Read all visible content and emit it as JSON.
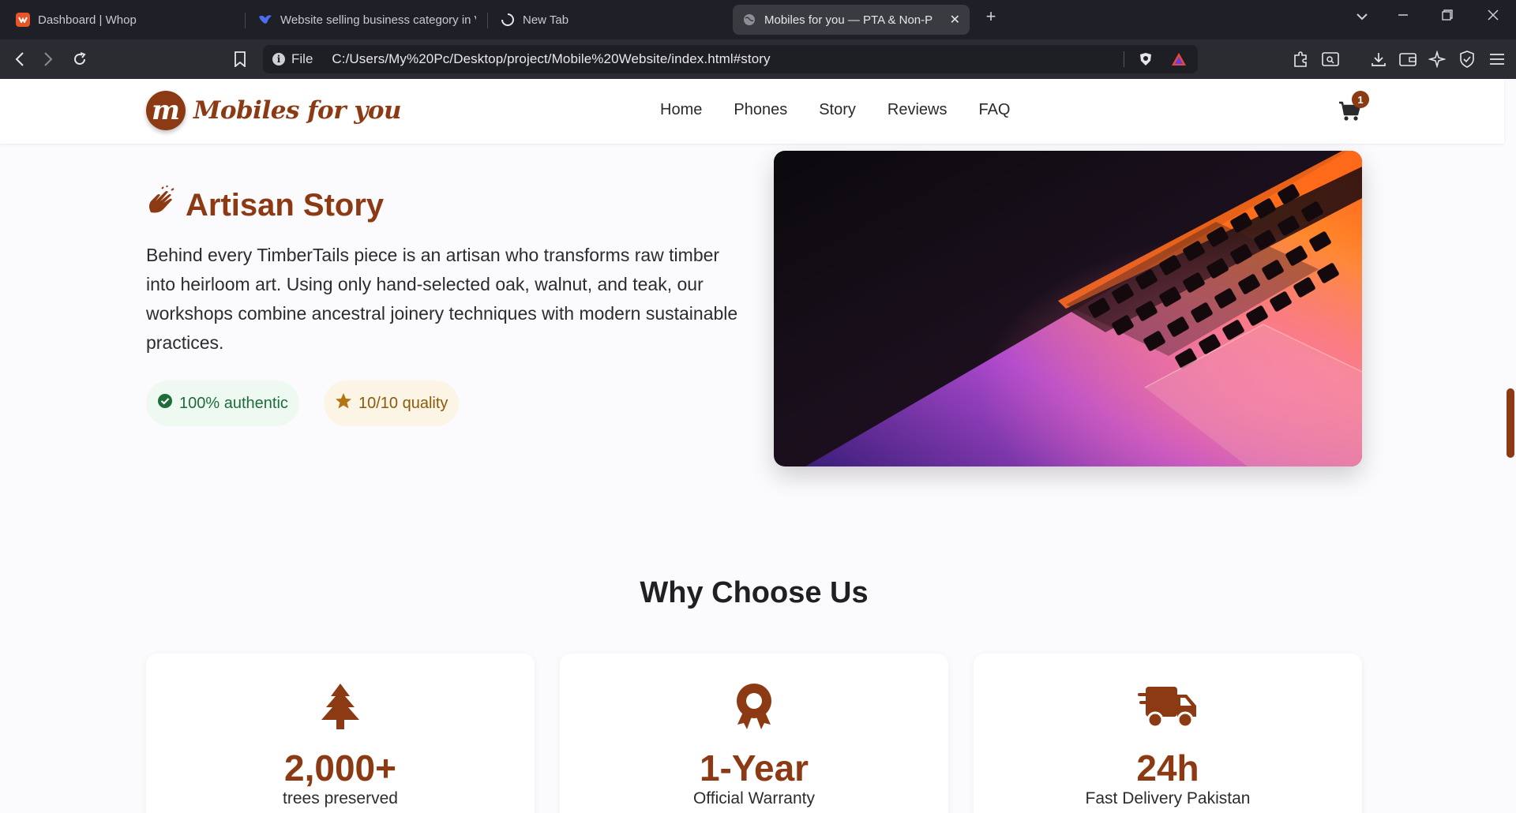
{
  "browser": {
    "tabs": [
      {
        "title": "Dashboard | Whop",
        "icon": "whop-icon"
      },
      {
        "title": "Website selling business category in V",
        "icon": "bird-icon"
      },
      {
        "title": "New Tab",
        "icon": "loading-icon"
      },
      {
        "title": "Mobiles for you — PTA & Non-P",
        "icon": "globe-icon",
        "active": true
      }
    ],
    "url_scheme": "File",
    "url": "C:/Users/My%20Pc/Desktop/project/Mobile%20Website/index.html#story"
  },
  "header": {
    "logo_initial": "m",
    "logo_text": "Mobiles for you",
    "nav": [
      "Home",
      "Phones",
      "Story",
      "Reviews",
      "FAQ"
    ],
    "cart_count": "1"
  },
  "story": {
    "title": "Artisan Story",
    "body": "Behind every TimberTails piece is an artisan who transforms raw timber into heirloom art. Using only hand-selected oak, walnut, and teak, our workshops combine ancestral joinery techniques with modern sustainable practices.",
    "badges": [
      "100% authentic",
      "10/10 quality"
    ]
  },
  "why": {
    "title": "Why Choose Us",
    "cards": [
      {
        "icon": "tree-icon",
        "value": "2,000+",
        "label": "trees preserved"
      },
      {
        "icon": "award-icon",
        "value": "1-Year",
        "label": "Official Warranty"
      },
      {
        "icon": "truck-icon",
        "value": "24h",
        "label": "Fast Delivery Pakistan"
      }
    ]
  },
  "colors": {
    "brand": "#8b3a14",
    "success": "#1f6b3a",
    "star": "#b5740f",
    "browser_bg": "#1f2027"
  }
}
